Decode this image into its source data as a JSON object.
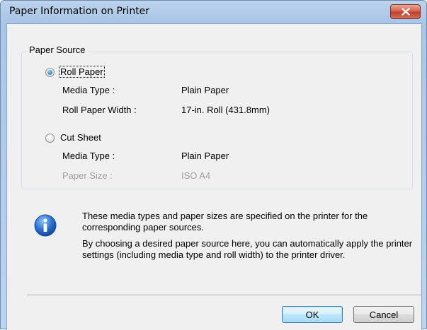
{
  "window": {
    "title": "Paper Information on Printer"
  },
  "paper_source": {
    "group_label": "Paper Source",
    "roll_paper": {
      "label": "Roll Paper",
      "selected": true,
      "media_type_label": "Media Type :",
      "media_type_value": "Plain Paper",
      "width_label": "Roll Paper Width :",
      "width_value": "17-in. Roll (431.8mm)"
    },
    "cut_sheet": {
      "label": "Cut Sheet",
      "selected": false,
      "media_type_label": "Media Type :",
      "media_type_value": "Plain Paper",
      "paper_size_label": "Paper Size :",
      "paper_size_value": "ISO A4"
    }
  },
  "info": {
    "line1": "These media types and paper sizes are specified on the printer for the corresponding paper sources.",
    "line2": "By choosing a desired paper source here, you can automatically apply the printer settings (including media type and roll width) to the printer driver."
  },
  "buttons": {
    "ok": "OK",
    "cancel": "Cancel"
  },
  "icons": {
    "close": "close-icon",
    "info": "info-icon"
  }
}
